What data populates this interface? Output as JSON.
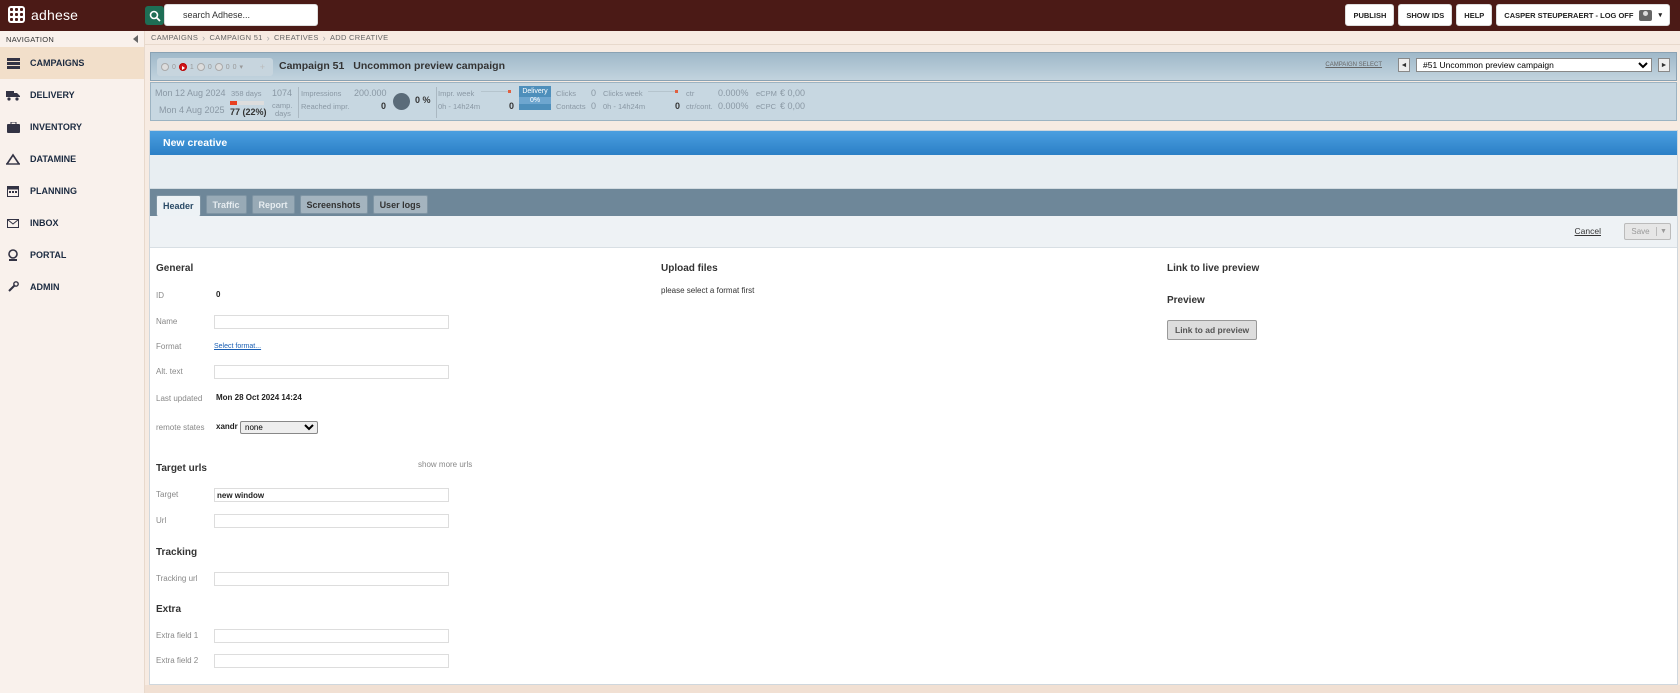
{
  "topbar": {
    "logo_text": "adhese",
    "search_placeholder": "search Adhese...",
    "buttons": {
      "publish": "PUBLISH",
      "show_ids": "SHOW IDS",
      "help": "HELP",
      "user": "CASPER STEUPERAERT - LOG OFF"
    }
  },
  "sidebar": {
    "header": "NAVIGATION",
    "items": [
      {
        "label": "CAMPAIGNS",
        "icon": "campaigns-icon"
      },
      {
        "label": "DELIVERY",
        "icon": "truck-icon"
      },
      {
        "label": "INVENTORY",
        "icon": "briefcase-icon"
      },
      {
        "label": "DATAMINE",
        "icon": "datamine-icon"
      },
      {
        "label": "PLANNING",
        "icon": "calendar-icon"
      },
      {
        "label": "INBOX",
        "icon": "mail-icon"
      },
      {
        "label": "PORTAL",
        "icon": "portal-icon"
      },
      {
        "label": "ADMIN",
        "icon": "wrench-icon"
      }
    ]
  },
  "breadcrumb": [
    "CAMPAIGNS",
    "CAMPAIGN 51",
    "CREATIVES",
    "ADD CREATIVE"
  ],
  "campaign": {
    "status_counts": [
      "0",
      "1",
      "0",
      "0",
      "0"
    ],
    "number": "Campaign 51",
    "name": "Uncommon preview campaign",
    "select_label": "CAMPAIGN SELECT",
    "selected": "#51 Uncommon preview campaign",
    "prev": "◄",
    "next": "►"
  },
  "stats": {
    "start_date": "Mon 12 Aug 2024",
    "end_date": "Mon 4 Aug 2025",
    "days_label": "358 days",
    "days_elapsed": "77 (22%)",
    "progress_fraction": 0.22,
    "camp_days_value": "1074",
    "camp_days_label1": "camp.",
    "camp_days_label2": "days",
    "impressions_label": "Impressions",
    "impressions_value": "200.000",
    "reached_label": "Reached impr.",
    "reached_value": "0",
    "percent": "0 %",
    "impr_week_label": "Impr. week",
    "impr_week_range": "0h - 14h24m",
    "impr_week_value": "0",
    "delivery_label": "Delivery",
    "delivery_pct": "0%",
    "clicks_label": "Clicks",
    "clicks_value": "0",
    "contacts_label": "Contacts",
    "contacts_value": "0",
    "clicks_week_label": "Clicks week",
    "clicks_week_range": "0h - 14h24m",
    "clicks_week_value": "0",
    "ctr_label": "ctr",
    "ctr_value": "0.000%",
    "ctrcont_label": "ctr/cont.",
    "ctrcont_value": "0.000%",
    "ecpm_label": "eCPM",
    "ecpm_value": "€ 0,00",
    "ecpc_label": "eCPC",
    "ecpc_value": "€ 0,00"
  },
  "panel": {
    "title": "New creative",
    "tabs": [
      {
        "label": "Header",
        "state": "active"
      },
      {
        "label": "Traffic",
        "state": "disabled"
      },
      {
        "label": "Report",
        "state": "disabled"
      },
      {
        "label": "Screenshots",
        "state": "normal"
      },
      {
        "label": "User logs",
        "state": "normal"
      }
    ],
    "cancel": "Cancel",
    "save": "Save",
    "save_caret": "▼"
  },
  "form": {
    "general_title": "General",
    "id_label": "ID",
    "id_value": "0",
    "name_label": "Name",
    "name_value": "",
    "format_label": "Format",
    "format_link": "Select format...",
    "alt_label": "Alt. text",
    "alt_value": "",
    "last_updated_label": "Last updated",
    "last_updated_value": "Mon 28 Oct 2024 14:24",
    "remote_label": "remote states",
    "remote_name": "xandr",
    "remote_selected": "none",
    "target_urls_title": "Target urls",
    "show_more": "show more urls",
    "target_label": "Target",
    "target_value": "new window",
    "url_label": "Url",
    "url_value": "",
    "tracking_title": "Tracking",
    "tracking_label": "Tracking url",
    "tracking_value": "",
    "extra_title": "Extra",
    "extra1_label": "Extra field 1",
    "extra1_value": "",
    "extra2_label": "Extra field 2",
    "extra2_value": "",
    "upload_title": "Upload files",
    "upload_text": "please select a format first",
    "live_preview_title": "Link to live preview",
    "preview_title": "Preview",
    "preview_button": "Link to ad preview"
  },
  "colors": {
    "topbar": "#4b1a16",
    "search_button": "#1e6e55",
    "panel_header": "#2b7fc6",
    "tab_strip": "#6e8799",
    "sidebar_active": "#f2dfca"
  }
}
